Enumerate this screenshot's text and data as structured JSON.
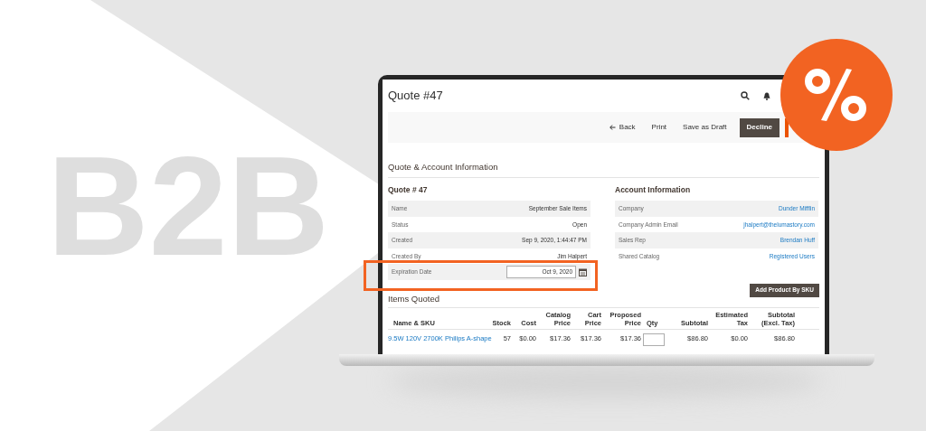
{
  "banner": {
    "heading": "B2B"
  },
  "page": {
    "title": "Quote #47",
    "toolbar": [
      {
        "kind": "back",
        "label": "Back"
      },
      {
        "kind": "link",
        "label": "Print"
      },
      {
        "kind": "link",
        "label": "Save as Draft"
      },
      {
        "kind": "dark",
        "label": "Decline"
      },
      {
        "kind": "primary"
      }
    ],
    "section_title": "Quote & Account Information",
    "quote": {
      "heading": "Quote # 47",
      "rows": [
        {
          "kind": "text",
          "label": "Name",
          "value": "September Sale Items",
          "highlighted": false
        },
        {
          "kind": "text",
          "label": "Status",
          "value": "Open",
          "highlighted": false
        },
        {
          "kind": "text",
          "label": "Created",
          "value": "Sep 9, 2020, 1:44:47 PM",
          "highlighted": false
        },
        {
          "kind": "text",
          "label": "Created By",
          "value": "Jim Halpert",
          "highlighted": false
        },
        {
          "kind": "date",
          "label": "Expiration Date",
          "value": "Oct 9, 2020",
          "highlighted": true
        }
      ]
    },
    "account": {
      "heading": "Account Information",
      "rows": [
        {
          "label": "Company",
          "value": "Dunder Mifflin"
        },
        {
          "label": "Company Admin Email",
          "value": "jhalpert@thelumastory.com"
        },
        {
          "label": "Sales Rep",
          "value": "Brendan Huff"
        },
        {
          "label": "Shared Catalog",
          "value": "Registered Users"
        }
      ]
    },
    "items": {
      "title": "Items Quoted",
      "add_button": "Add Product By SKU",
      "columns": [
        {
          "label": "Name & SKU",
          "kind": "link"
        },
        {
          "label": "Stock",
          "kind": "text"
        },
        {
          "label": "Cost",
          "kind": "text"
        },
        {
          "label": "Catalog\nPrice",
          "kind": "text"
        },
        {
          "label": "Cart\nPrice",
          "kind": "text"
        },
        {
          "label": "Proposed\nPrice",
          "kind": "text"
        },
        {
          "label": "Qty",
          "kind": "input"
        },
        {
          "label": "Subtotal",
          "kind": "text"
        },
        {
          "label": "Estimated\nTax",
          "kind": "text"
        },
        {
          "label": "Subtotal\n(Excl. Tax)",
          "kind": "text"
        }
      ],
      "rows": [
        [
          "9.5W 120V 2700K Philips A-shape",
          "57",
          "$0.00",
          "$17.36",
          "$17.36",
          "$17.36",
          null,
          "$86.80",
          "$0.00",
          "$86.80"
        ]
      ]
    }
  }
}
